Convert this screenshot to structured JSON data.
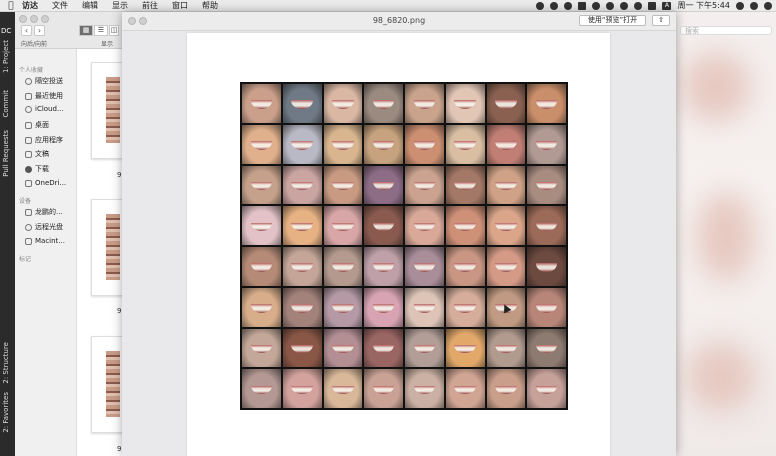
{
  "menubar": {
    "items": [
      "访达",
      "文件",
      "编辑",
      "显示",
      "前往",
      "窗口",
      "帮助"
    ],
    "clock": "周一 下午5:44"
  },
  "ide": {
    "project_label": "DC",
    "tabs": [
      "1: Project",
      "Commit",
      "Pull Requests",
      "2: Structure",
      "2: Favorites"
    ]
  },
  "finder": {
    "toolbar": {
      "nav_label": "向后/向前",
      "view_label": "显示"
    },
    "sidebar": {
      "sections": [
        {
          "title": "个人收藏",
          "items": [
            "隔空投送",
            "最近使用",
            "iCloud...",
            "桌面",
            "应用程序",
            "文稿",
            "下载",
            "OneDri..."
          ]
        },
        {
          "title": "设备",
          "items": [
            "龙鹏的...",
            "远程光盘",
            "Macint..."
          ]
        },
        {
          "title": "标记",
          "items": []
        }
      ]
    },
    "thumb_labels": [
      "9",
      "9",
      "9"
    ],
    "bg_search_placeholder": "搜索"
  },
  "preview": {
    "title": "98_6820.png",
    "open_button": "使用“预览”打开",
    "share_icon": "share-icon"
  },
  "image_grid": {
    "rows": 8,
    "cols": 8,
    "tones": [
      "#caa08a",
      "#6f7a86",
      "#d9b7a3",
      "#9a8a80",
      "#c9a38c",
      "#e1c5b5",
      "#8a6150",
      "#c98e6a",
      "#e0b08c",
      "#b9b9c5",
      "#d8b58f",
      "#c7a27e",
      "#cc8f72",
      "#d9bea2",
      "#c07e74",
      "#b19a93",
      "#c5a08a",
      "#caa4a1",
      "#c89a82",
      "#8d6c86",
      "#caa28f",
      "#a47866",
      "#cfa186",
      "#a98c80",
      "#e2c2c6",
      "#e6b183",
      "#d8a6a7",
      "#8a5a4f",
      "#d9a899",
      "#cf9078",
      "#dba58a",
      "#9c6a58",
      "#b58a76",
      "#c4a597",
      "#b49a8e",
      "#bfa0a8",
      "#a98d98",
      "#c89683",
      "#d49a86",
      "#6c4a40",
      "#d7ad8a",
      "#a3827b",
      "#b59aa6",
      "#d8a4b4",
      "#ddc4b7",
      "#d5ad9a",
      "#c09a82",
      "#b88679",
      "#c3a798",
      "#8a5747",
      "#b38f94",
      "#9a6664",
      "#b29e97",
      "#e1a86a",
      "#b19a8e",
      "#8d7a70",
      "#b39893",
      "#d3a29d",
      "#d9b89a",
      "#caa295",
      "#cbb0a4",
      "#d1a594",
      "#c99e8a",
      "#c6a19a"
    ]
  }
}
